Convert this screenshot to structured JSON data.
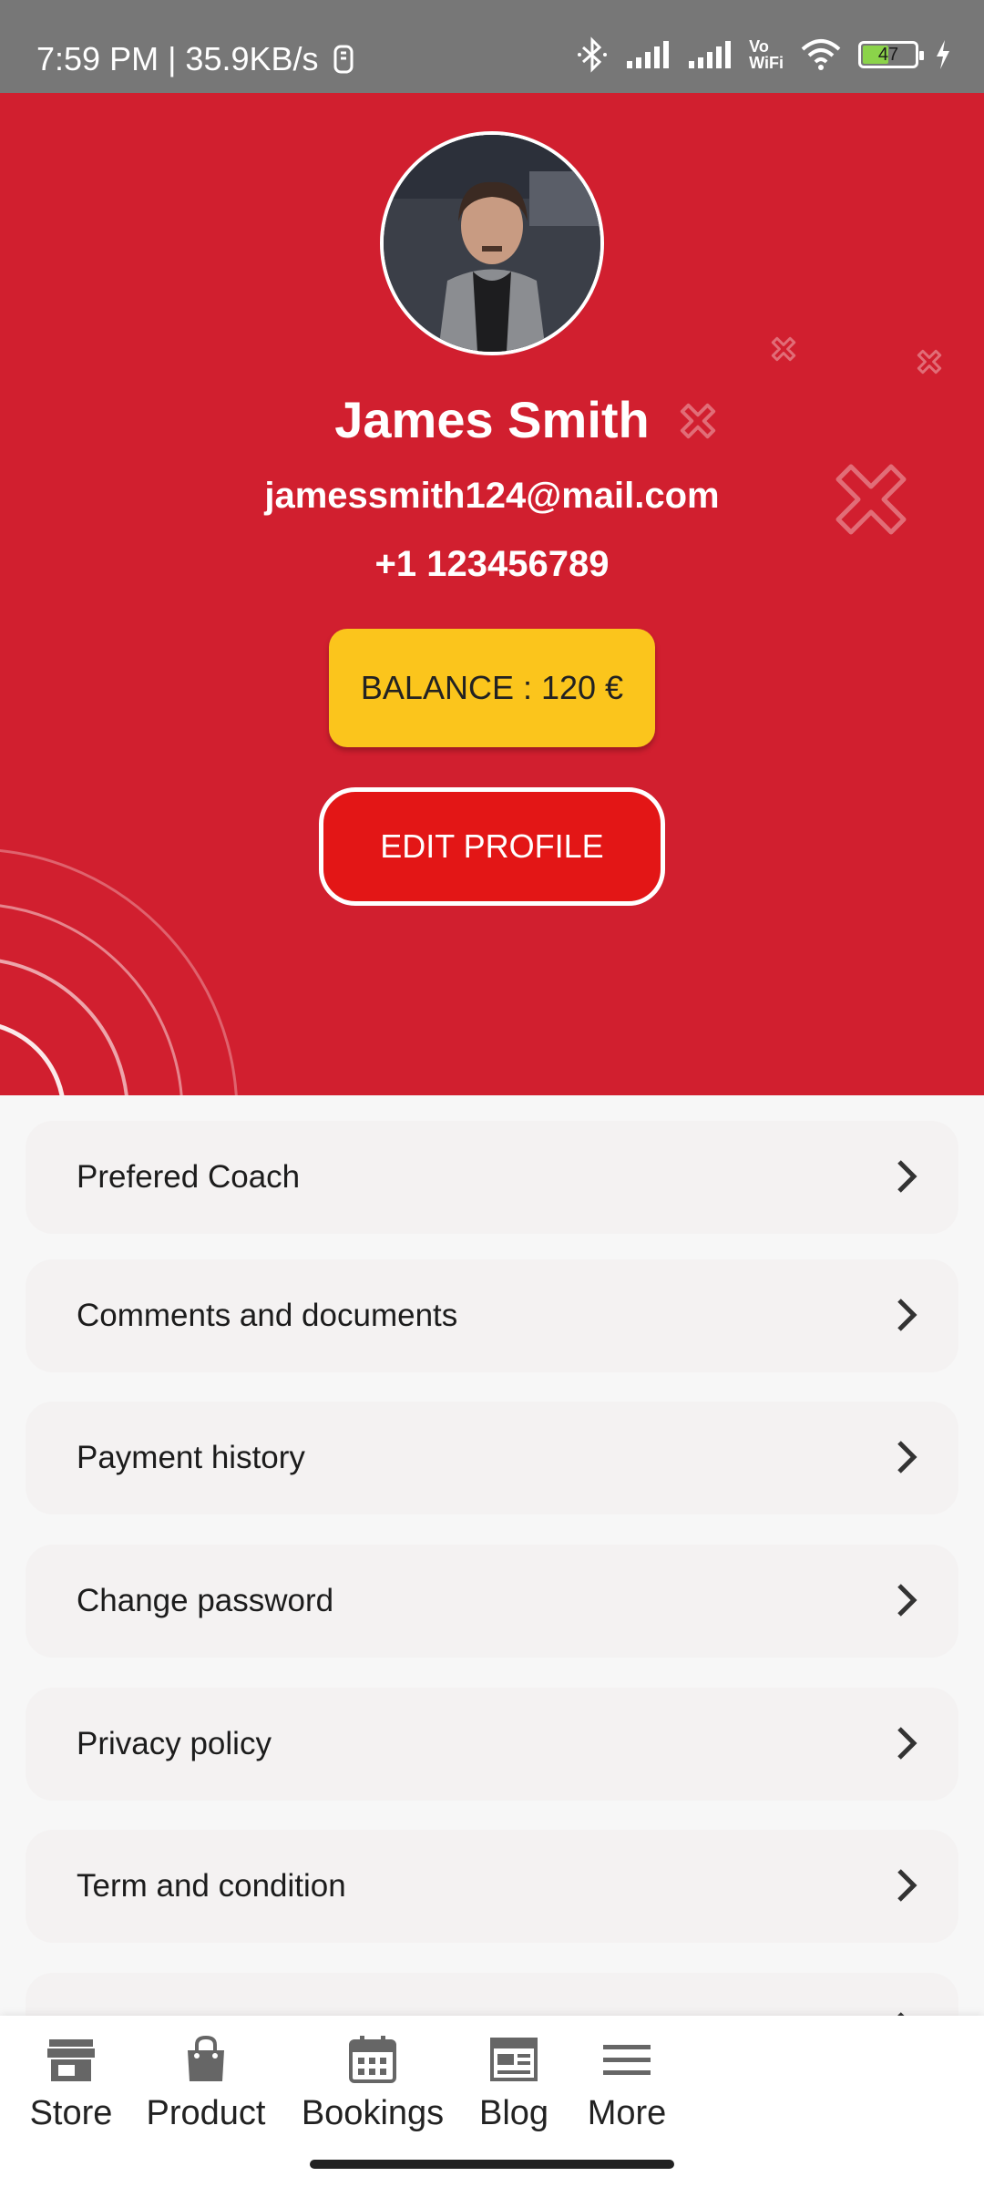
{
  "status_bar": {
    "time_speed": "7:59 PM | 35.9KB/s",
    "vowifi_top": "Vo",
    "vowifi_bottom": "WiFi",
    "battery_level": "47"
  },
  "profile": {
    "name": "James Smith",
    "email": "jamessmith124@mail.com",
    "phone": "+1 123456789",
    "balance_label": "BALANCE : 120 €",
    "edit_label": "EDIT PROFILE"
  },
  "menu": {
    "items": [
      {
        "label": "Prefered Coach"
      },
      {
        "label": "Comments and documents"
      },
      {
        "label": "Payment history"
      },
      {
        "label": "Change password"
      },
      {
        "label": "Privacy policy"
      },
      {
        "label": "Term and condition"
      }
    ]
  },
  "bottom_nav": {
    "items": [
      {
        "label": "Store",
        "icon": "store-icon"
      },
      {
        "label": "Product",
        "icon": "shopping-bag-icon"
      },
      {
        "label": "Bookings",
        "icon": "calendar-icon"
      },
      {
        "label": "Blog",
        "icon": "newspaper-icon"
      },
      {
        "label": "More",
        "icon": "menu-icon"
      }
    ]
  },
  "colors": {
    "header": "#d11f2f",
    "balance": "#fbc51c",
    "edit_button": "#e31616",
    "status_bar": "#777777"
  }
}
